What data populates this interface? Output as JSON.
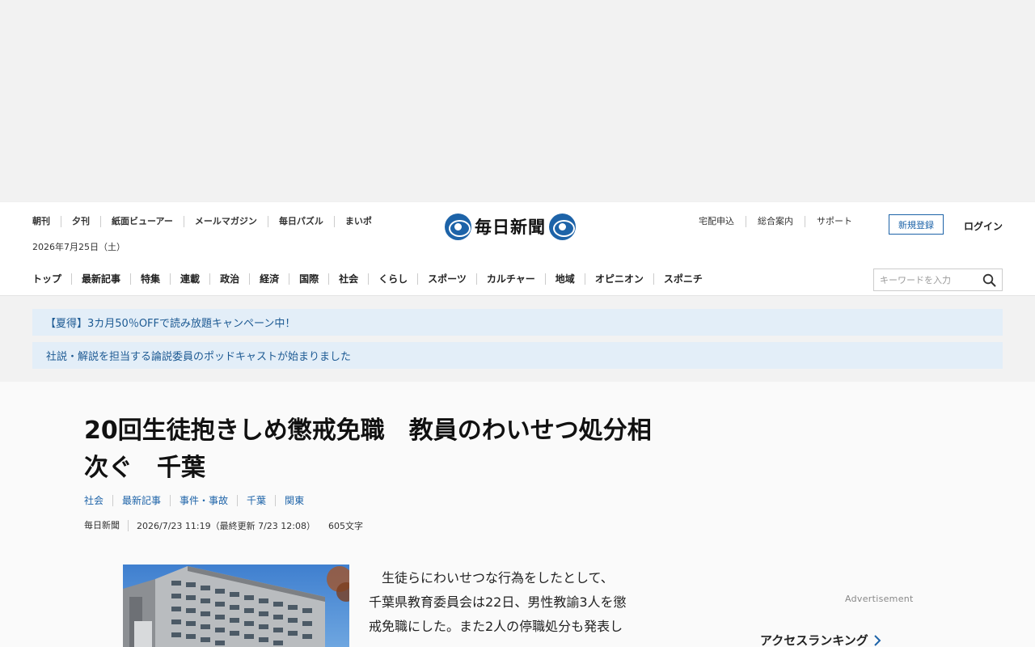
{
  "header": {
    "util_left": [
      "朝刊",
      "夕刊",
      "紙面ビューアー",
      "メールマガジン",
      "毎日パズル",
      "まいポ"
    ],
    "date": "2026年7月25日（土）",
    "logo_text": "毎日新聞",
    "util_right": [
      "宅配申込",
      "総合案内",
      "サポート"
    ],
    "register_label": "新規登録",
    "login_label": "ログイン"
  },
  "nav": {
    "items": [
      "トップ",
      "最新記事",
      "特集",
      "連載",
      "政治",
      "経済",
      "国際",
      "社会",
      "くらし",
      "スポーツ",
      "カルチャー",
      "地域",
      "オピニオン",
      "スポニチ"
    ]
  },
  "search": {
    "placeholder": "キーワードを入力",
    "value": ""
  },
  "notices": [
    "【夏得】3カ月50％OFFで読み放題キャンペーン中！",
    "社説・解説を担当する論説委員のポッドキャストが始まりました"
  ],
  "article": {
    "title_line1": "20回生徒抱きしめ懲戒免職　教員のわいせつ処分相",
    "title_line2": "次ぐ　千葉",
    "categories": [
      "社会",
      "最新記事",
      "事件・事故",
      "千葉",
      "関東"
    ],
    "source": "毎日新聞",
    "published": "2026/7/23 11:19（最終更新 7/23 12:08）",
    "char_count": "605文字",
    "body_lines": [
      "　生徒らにわいせつな行為をしたとして、",
      "千葉県教育委員会は22日、男性教諭3人を懲",
      "戒免職にした。また2人の停職処分も発表し"
    ]
  },
  "sidebar": {
    "ad_label": "Advertisement",
    "ranking_title": "アクセスランキング"
  },
  "colors": {
    "brand": "#1d63a8",
    "notice_bg": "#e3eef8",
    "notice_text": "#1d5a93"
  }
}
